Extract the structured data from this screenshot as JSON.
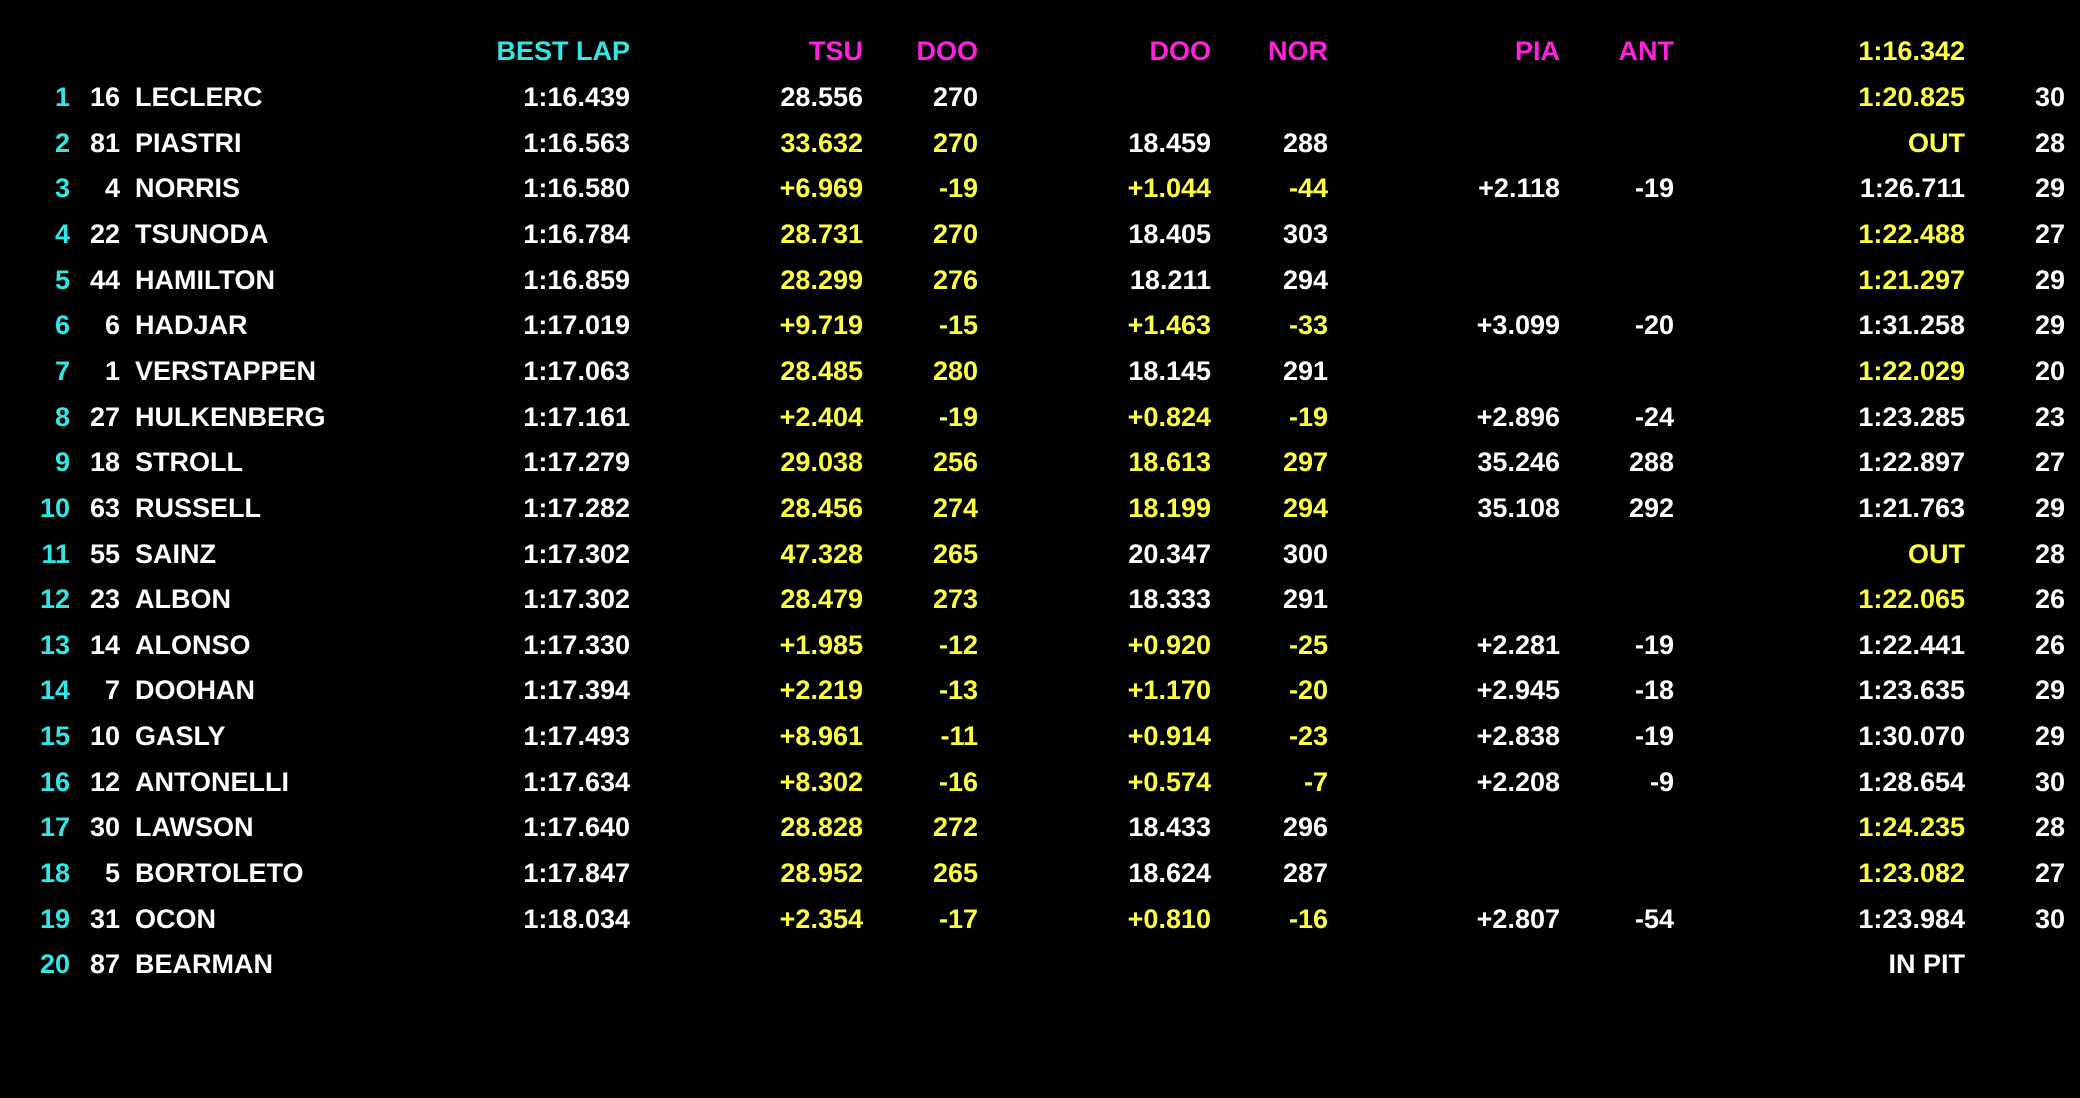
{
  "colors": {
    "background": "#000000",
    "text_white": "#ffffff",
    "text_yellow": "#ffff44",
    "text_cyan": "#33e6e6",
    "text_magenta": "#ff22dd"
  },
  "header": {
    "best_lap": "BEST LAP",
    "t1_label": "TSU",
    "s1_label": "DOO",
    "t2_label": "DOO",
    "s2_label": "NOR",
    "t3_label": "PIA",
    "s3_label": "ANT",
    "fastest": "1:16.342"
  },
  "rows": [
    {
      "pos": "1",
      "num": "16",
      "name": "LECLERC",
      "best": "1:16.439",
      "t1": "28.556",
      "s1": "270",
      "t2": "",
      "s2": "",
      "t3": "",
      "s3": "",
      "last": "1:20.825",
      "laps": "30",
      "c1": "w",
      "c2": "w",
      "c3": "w",
      "cl": "y"
    },
    {
      "pos": "2",
      "num": "81",
      "name": "PIASTRI",
      "best": "1:16.563",
      "t1": "33.632",
      "s1": "270",
      "t2": "18.459",
      "s2": "288",
      "t3": "",
      "s3": "",
      "last": "OUT",
      "laps": "28",
      "c1": "y",
      "c2": "w",
      "c3": "w",
      "cl": "y"
    },
    {
      "pos": "3",
      "num": "4",
      "name": "NORRIS",
      "best": "1:16.580",
      "t1": "+6.969",
      "s1": "-19",
      "t2": "+1.044",
      "s2": "-44",
      "t3": "+2.118",
      "s3": "-19",
      "last": "1:26.711",
      "laps": "29",
      "c1": "y",
      "c2": "y",
      "c3": "w",
      "cl": "w"
    },
    {
      "pos": "4",
      "num": "22",
      "name": "TSUNODA",
      "best": "1:16.784",
      "t1": "28.731",
      "s1": "270",
      "t2": "18.405",
      "s2": "303",
      "t3": "",
      "s3": "",
      "last": "1:22.488",
      "laps": "27",
      "c1": "y",
      "c2": "w",
      "c3": "w",
      "cl": "y"
    },
    {
      "pos": "5",
      "num": "44",
      "name": "HAMILTON",
      "best": "1:16.859",
      "t1": "28.299",
      "s1": "276",
      "t2": "18.211",
      "s2": "294",
      "t3": "",
      "s3": "",
      "last": "1:21.297",
      "laps": "29",
      "c1": "y",
      "c2": "w",
      "c3": "w",
      "cl": "y"
    },
    {
      "pos": "6",
      "num": "6",
      "name": "HADJAR",
      "best": "1:17.019",
      "t1": "+9.719",
      "s1": "-15",
      "t2": "+1.463",
      "s2": "-33",
      "t3": "+3.099",
      "s3": "-20",
      "last": "1:31.258",
      "laps": "29",
      "c1": "y",
      "c2": "y",
      "c3": "w",
      "cl": "w"
    },
    {
      "pos": "7",
      "num": "1",
      "name": "VERSTAPPEN",
      "best": "1:17.063",
      "t1": "28.485",
      "s1": "280",
      "t2": "18.145",
      "s2": "291",
      "t3": "",
      "s3": "",
      "last": "1:22.029",
      "laps": "20",
      "c1": "y",
      "c2": "w",
      "c3": "w",
      "cl": "y"
    },
    {
      "pos": "8",
      "num": "27",
      "name": "HULKENBERG",
      "best": "1:17.161",
      "t1": "+2.404",
      "s1": "-19",
      "t2": "+0.824",
      "s2": "-19",
      "t3": "+2.896",
      "s3": "-24",
      "last": "1:23.285",
      "laps": "23",
      "c1": "y",
      "c2": "y",
      "c3": "w",
      "cl": "w"
    },
    {
      "pos": "9",
      "num": "18",
      "name": "STROLL",
      "best": "1:17.279",
      "t1": "29.038",
      "s1": "256",
      "t2": "18.613",
      "s2": "297",
      "t3": "35.246",
      "s3": "288",
      "last": "1:22.897",
      "laps": "27",
      "c1": "y",
      "c2": "y",
      "c3": "w",
      "cl": "w"
    },
    {
      "pos": "10",
      "num": "63",
      "name": "RUSSELL",
      "best": "1:17.282",
      "t1": "28.456",
      "s1": "274",
      "t2": "18.199",
      "s2": "294",
      "t3": "35.108",
      "s3": "292",
      "last": "1:21.763",
      "laps": "29",
      "c1": "y",
      "c2": "y",
      "c3": "w",
      "cl": "w"
    },
    {
      "pos": "11",
      "num": "55",
      "name": "SAINZ",
      "best": "1:17.302",
      "t1": "47.328",
      "s1": "265",
      "t2": "20.347",
      "s2": "300",
      "t3": "",
      "s3": "",
      "last": "OUT",
      "laps": "28",
      "c1": "y",
      "c2": "w",
      "c3": "w",
      "cl": "y"
    },
    {
      "pos": "12",
      "num": "23",
      "name": "ALBON",
      "best": "1:17.302",
      "t1": "28.479",
      "s1": "273",
      "t2": "18.333",
      "s2": "291",
      "t3": "",
      "s3": "",
      "last": "1:22.065",
      "laps": "26",
      "c1": "y",
      "c2": "w",
      "c3": "w",
      "cl": "y"
    },
    {
      "pos": "13",
      "num": "14",
      "name": "ALONSO",
      "best": "1:17.330",
      "t1": "+1.985",
      "s1": "-12",
      "t2": "+0.920",
      "s2": "-25",
      "t3": "+2.281",
      "s3": "-19",
      "last": "1:22.441",
      "laps": "26",
      "c1": "y",
      "c2": "y",
      "c3": "w",
      "cl": "w"
    },
    {
      "pos": "14",
      "num": "7",
      "name": "DOOHAN",
      "best": "1:17.394",
      "t1": "+2.219",
      "s1": "-13",
      "t2": "+1.170",
      "s2": "-20",
      "t3": "+2.945",
      "s3": "-18",
      "last": "1:23.635",
      "laps": "29",
      "c1": "y",
      "c2": "y",
      "c3": "w",
      "cl": "w"
    },
    {
      "pos": "15",
      "num": "10",
      "name": "GASLY",
      "best": "1:17.493",
      "t1": "+8.961",
      "s1": "-11",
      "t2": "+0.914",
      "s2": "-23",
      "t3": "+2.838",
      "s3": "-19",
      "last": "1:30.070",
      "laps": "29",
      "c1": "y",
      "c2": "y",
      "c3": "w",
      "cl": "w"
    },
    {
      "pos": "16",
      "num": "12",
      "name": "ANTONELLI",
      "best": "1:17.634",
      "t1": "+8.302",
      "s1": "-16",
      "t2": "+0.574",
      "s2": "-7",
      "t3": "+2.208",
      "s3": "-9",
      "last": "1:28.654",
      "laps": "30",
      "c1": "y",
      "c2": "y",
      "c3": "w",
      "cl": "w"
    },
    {
      "pos": "17",
      "num": "30",
      "name": "LAWSON",
      "best": "1:17.640",
      "t1": "28.828",
      "s1": "272",
      "t2": "18.433",
      "s2": "296",
      "t3": "",
      "s3": "",
      "last": "1:24.235",
      "laps": "28",
      "c1": "y",
      "c2": "w",
      "c3": "w",
      "cl": "y"
    },
    {
      "pos": "18",
      "num": "5",
      "name": "BORTOLETO",
      "best": "1:17.847",
      "t1": "28.952",
      "s1": "265",
      "t2": "18.624",
      "s2": "287",
      "t3": "",
      "s3": "",
      "last": "1:23.082",
      "laps": "27",
      "c1": "y",
      "c2": "w",
      "c3": "w",
      "cl": "y"
    },
    {
      "pos": "19",
      "num": "31",
      "name": "OCON",
      "best": "1:18.034",
      "t1": "+2.354",
      "s1": "-17",
      "t2": "+0.810",
      "s2": "-16",
      "t3": "+2.807",
      "s3": "-54",
      "last": "1:23.984",
      "laps": "30",
      "c1": "y",
      "c2": "y",
      "c3": "w",
      "cl": "w"
    },
    {
      "pos": "20",
      "num": "87",
      "name": "BEARMAN",
      "best": "",
      "t1": "",
      "s1": "",
      "t2": "",
      "s2": "",
      "t3": "",
      "s3": "",
      "last": "IN PIT",
      "laps": "",
      "c1": "w",
      "c2": "w",
      "c3": "w",
      "cl": "w"
    }
  ]
}
